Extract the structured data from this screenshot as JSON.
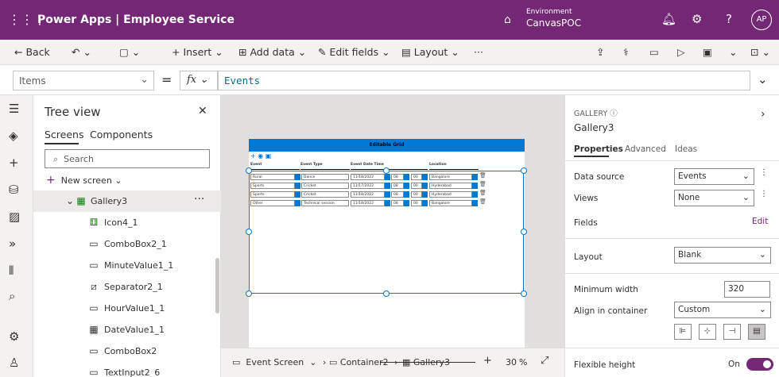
{
  "app": {
    "title": "Power Apps  |  Employee Service",
    "env_label": "Environment",
    "env_name": "CanvasPOC",
    "avatar": "AP"
  },
  "commands": {
    "back": "Back",
    "insert": "Insert",
    "add_data": "Add data",
    "edit_fields": "Edit fields",
    "layout": "Layout",
    "more": "···"
  },
  "formula": {
    "property": "Items",
    "fx": "fx",
    "expression": "Events"
  },
  "tree": {
    "title": "Tree view",
    "tabs": [
      "Screens",
      "Components"
    ],
    "search_placeholder": "Search",
    "new_screen": "New screen",
    "selected": "Gallery3",
    "items": [
      "Icon4_1",
      "ComboBox2_1",
      "MinuteValue1_1",
      "Separator2_1",
      "HourValue1_1",
      "DateValue1_1",
      "ComboBox2",
      "TextInput2_6"
    ]
  },
  "grid": {
    "title": "Editable Grid",
    "headers": [
      "Event",
      "Event Type",
      "Event Date Time",
      "Location"
    ],
    "rows": [
      {
        "event": "Rural",
        "type": "Dance",
        "date": "11/18/2022",
        "hour": "08",
        "min": "00",
        "loc": "Bangalore"
      },
      {
        "event": "Sports",
        "type": "Cricket",
        "date": "11/17/2022",
        "hour": "08",
        "min": "00",
        "loc": "Hyderabad"
      },
      {
        "event": "Sports",
        "type": "Cricket",
        "date": "11/18/2022",
        "hour": "08",
        "min": "00",
        "loc": "Hyderabad"
      },
      {
        "event": "Other",
        "type": "Technical session",
        "date": "11/18/2022",
        "hour": "08",
        "min": "00",
        "loc": "Bangalore"
      }
    ]
  },
  "bottom": {
    "screen": "Event Screen",
    "container": "Container2",
    "gallery": "Gallery3",
    "zoom": "30",
    "pct": "%"
  },
  "props": {
    "type": "GALLERY",
    "name": "Gallery3",
    "tabs": [
      "Properties",
      "Advanced",
      "Ideas"
    ],
    "data_source_label": "Data source",
    "data_source": "Events",
    "views_label": "Views",
    "views": "None",
    "fields_label": "Fields",
    "edit": "Edit",
    "layout_label": "Layout",
    "layout": "Blank",
    "min_width_label": "Minimum width",
    "min_width": "320",
    "align_label": "Align in container",
    "align": "Custom",
    "flex_label": "Flexible height",
    "flex": "On"
  },
  "colors": {
    "brand": "#742774",
    "accent": "#0078d4"
  }
}
